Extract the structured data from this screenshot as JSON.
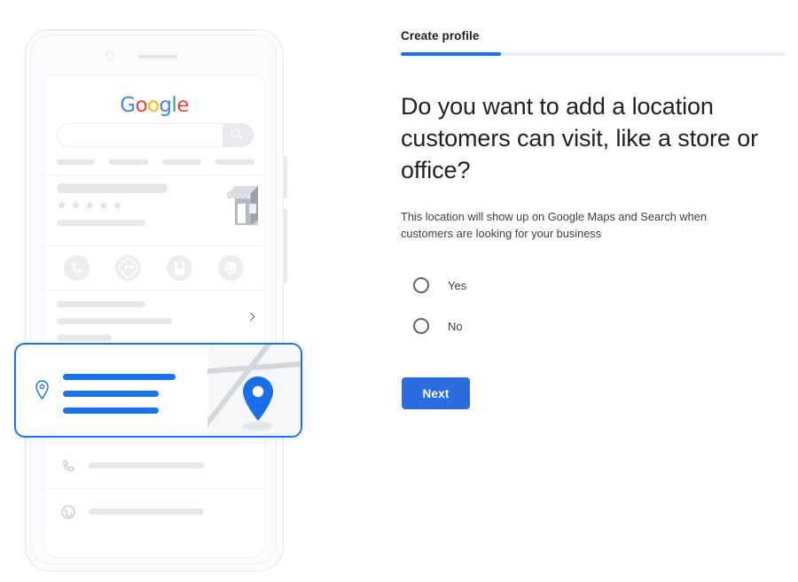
{
  "form": {
    "step_label": "Create profile",
    "progress_percent": 26,
    "headline": "Do you want to add a location customers can visit, like a store or office?",
    "subtext": "This location will show up on Google Maps and Search when customers are looking for your business",
    "options": [
      {
        "label": "Yes",
        "selected": false
      },
      {
        "label": "No",
        "selected": false
      }
    ],
    "next_label": "Next"
  },
  "phone_preview": {
    "brand_logo": {
      "letters": [
        {
          "char": "G",
          "color": "#4285f4"
        },
        {
          "char": "o",
          "color": "#ea4335"
        },
        {
          "char": "o",
          "color": "#fbbc05"
        },
        {
          "char": "g",
          "color": "#4285f4"
        },
        {
          "char": "l",
          "color": "#34a853"
        },
        {
          "char": "e",
          "color": "#ea4335"
        }
      ]
    },
    "search": {
      "icon": "search-icon",
      "value": "",
      "placeholder": ""
    },
    "nav_pills": 4,
    "business": {
      "star_rating_icons": 5,
      "star_glyph": "★",
      "illustration": "storefront-illustration"
    },
    "action_icons": [
      "call-icon",
      "directions-icon",
      "save-bookmark-icon",
      "website-globe-icon"
    ],
    "detail_rows": [
      {
        "icon": "clock-icon"
      },
      {
        "icon": "phone-icon"
      },
      {
        "icon": "globe-icon"
      }
    ],
    "chevron": "chevron-right-icon"
  },
  "location_card": {
    "pin_icon": "location-pin-icon",
    "map_marker_icon": "map-marker-icon",
    "text_lines": 3,
    "highlight_color": "#1a73e8"
  },
  "colors": {
    "accent_blue": "#1a73e8",
    "button_blue": "#2b6cdf",
    "progress_track": "#e8f0fe",
    "placeholder_gray": "#e4e6ea",
    "text_primary": "#202124",
    "text_secondary": "#3c4043"
  }
}
